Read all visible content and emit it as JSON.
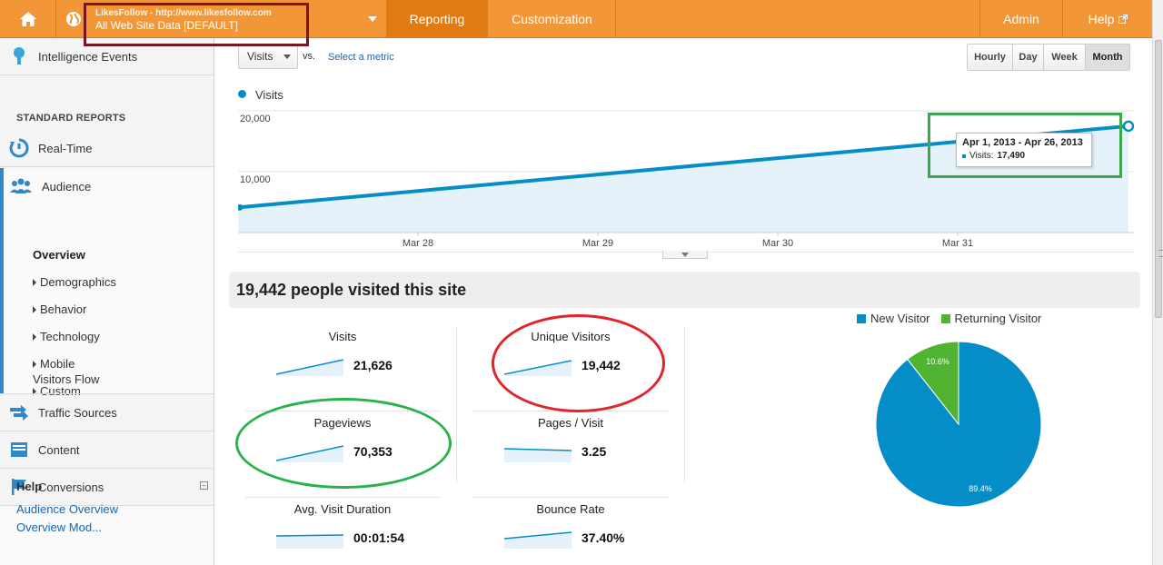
{
  "header": {
    "account_sub": "LikesFollow - http://www.likesfollow.com",
    "account_main": "All Web Site Data [DEFAULT]",
    "nav": {
      "reporting": "Reporting",
      "customization": "Customization",
      "admin": "Admin",
      "help": "Help"
    }
  },
  "sidebar": {
    "intelligence": "Intelligence Events",
    "standard_reports": "STANDARD REPORTS",
    "realtime": "Real-Time",
    "audience": "Audience",
    "audience_items": [
      "Overview",
      "Demographics",
      "Behavior",
      "Technology",
      "Mobile",
      "Custom",
      "Visitors Flow"
    ],
    "traffic": "Traffic Sources",
    "content": "Content",
    "conversions": "Conversions",
    "help_title": "Help",
    "help_links": [
      "Audience Overview",
      "Overview Mod..."
    ]
  },
  "controls": {
    "metric": "Visits",
    "vs": "vs.",
    "select_metric": "Select a metric",
    "ranges": [
      "Hourly",
      "Day",
      "Week",
      "Month"
    ],
    "active_range": "Month"
  },
  "chart_data": {
    "type": "line",
    "series": [
      {
        "name": "Visits",
        "color": "#058dc7"
      }
    ],
    "x_labels": [
      "Mar 28",
      "Mar 29",
      "Mar 30",
      "Mar 31"
    ],
    "y_ticks": [
      "20,000",
      "10,000"
    ],
    "ylim": [
      0,
      20000
    ],
    "start_value": 4130,
    "end_value": 17490,
    "tooltip": {
      "date": "Apr 1, 2013 - Apr 26, 2013",
      "label": "Visits:",
      "value": "17,490"
    }
  },
  "summary": {
    "headline": "19,442 people visited this site"
  },
  "metrics": [
    {
      "name": "Visits",
      "value": "21,626"
    },
    {
      "name": "Unique Visitors",
      "value": "19,442"
    },
    {
      "name": "Pageviews",
      "value": "70,353"
    },
    {
      "name": "Pages / Visit",
      "value": "3.25"
    },
    {
      "name": "Avg. Visit Duration",
      "value": "00:01:54"
    },
    {
      "name": "Bounce Rate",
      "value": "37.40%"
    }
  ],
  "pie": {
    "legend": [
      "New Visitor",
      "Returning Visitor"
    ],
    "colors": [
      "#058dc7",
      "#50b432"
    ],
    "values": [
      89.4,
      10.6
    ],
    "labels": [
      "89.4%",
      "10.6%"
    ]
  }
}
